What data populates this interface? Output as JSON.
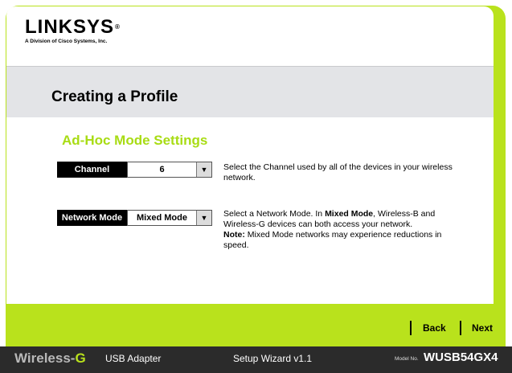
{
  "brand": {
    "logo_text": "LINKSYS",
    "logo_reg": "®",
    "logo_subtitle": "A Division of Cisco Systems, Inc."
  },
  "page": {
    "title": "Creating a Profile",
    "section_title": "Ad-Hoc Mode Settings"
  },
  "channel": {
    "label": "Channel",
    "value": "6",
    "description": "Select the Channel used by all of the devices in your wireless network."
  },
  "network_mode": {
    "label": "Network Mode",
    "value": "Mixed Mode",
    "description_1": "Select a Network Mode. In ",
    "description_bold_1": "Mixed Mode",
    "description_2": ", Wireless-B and Wireless-G devices can both access your network.",
    "note_label": "Note:",
    "note_text": " Mixed Mode networks may experience reductions in speed."
  },
  "nav": {
    "back_label": "Back",
    "next_label": "Next"
  },
  "footer": {
    "brand_prefix": "Wireless-",
    "brand_g": "G",
    "product": "USB Adapter",
    "wizard": "Setup Wizard  v1.1",
    "model_no_label": "Model No.",
    "model": "WUSB54GX4"
  },
  "colors": {
    "accent_green": "#b9e21c",
    "section_green": "#a8dc14",
    "footer_dark": "#2b2b2b"
  },
  "icons": {
    "dropdown": "triangle-down-icon"
  }
}
